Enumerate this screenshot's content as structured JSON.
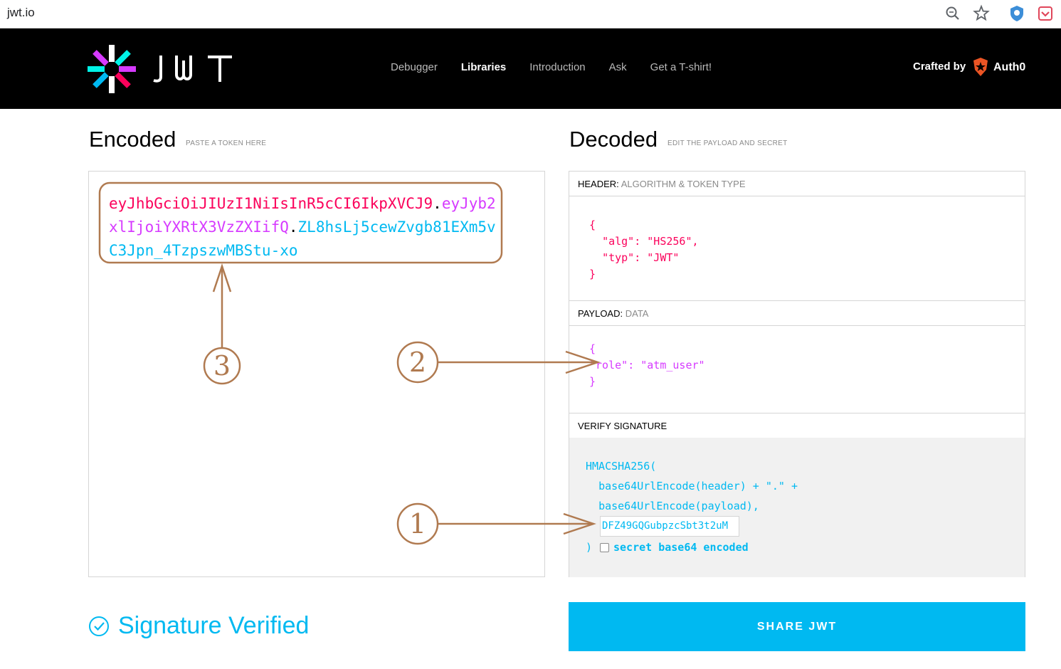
{
  "browser": {
    "url": "jwt.io",
    "icons": [
      "zoom-icon",
      "star-icon",
      "extension-icon",
      "pocket-icon"
    ]
  },
  "header": {
    "logo_text": "JWT",
    "nav": [
      "Debugger",
      "Libraries",
      "Introduction",
      "Ask",
      "Get a T-shirt!"
    ],
    "active_nav": "Libraries",
    "crafted_by": "Crafted by",
    "brand": "Auth0"
  },
  "encoded": {
    "title": "Encoded",
    "subtitle": "PASTE A TOKEN HERE",
    "token_header": "eyJhbGciOiJIUzI1NiIsInR5cCI6IkpXVCJ9",
    "token_payload": "eyJyb2xlIjoiYXRtX3VzZXIifQ",
    "token_signature": "ZL8hsLj5cewZvgb81EXm5vC3Jpn_4TzpszwMBStu-xo",
    "dot": "."
  },
  "decoded": {
    "title": "Decoded",
    "subtitle": "EDIT THE PAYLOAD AND SECRET",
    "header_panel": {
      "label": "HEADER:",
      "sublabel": "ALGORITHM & TOKEN TYPE",
      "open": "{",
      "line1_key": "\"alg\"",
      "line1_val": "\"HS256\"",
      "line2_key": "\"typ\"",
      "line2_val": "\"JWT\"",
      "close": "}"
    },
    "payload_panel": {
      "label": "PAYLOAD:",
      "sublabel": "DATA",
      "open": "{",
      "key": "\"role\"",
      "val": "\"atm_user\"",
      "close": "}"
    },
    "signature_panel": {
      "label": "VERIFY SIGNATURE",
      "line1": "HMACSHA256(",
      "line2": "base64UrlEncode(header) + \".\" +",
      "line3": "base64UrlEncode(payload),",
      "secret_value": "DFZ49GQGubpzcSbt3t2uM",
      "close": ")",
      "checkbox_label": "secret base64 encoded",
      "checkbox_checked": false
    }
  },
  "status": {
    "verified_text": "Signature Verified"
  },
  "share_button": "SHARE JWT",
  "annotations": [
    "1",
    "2",
    "3"
  ],
  "colors": {
    "header_red": "#fb015b",
    "payload_purple": "#d63aff",
    "signature_blue": "#00b9f1",
    "annotation_brown": "#b07a50"
  }
}
